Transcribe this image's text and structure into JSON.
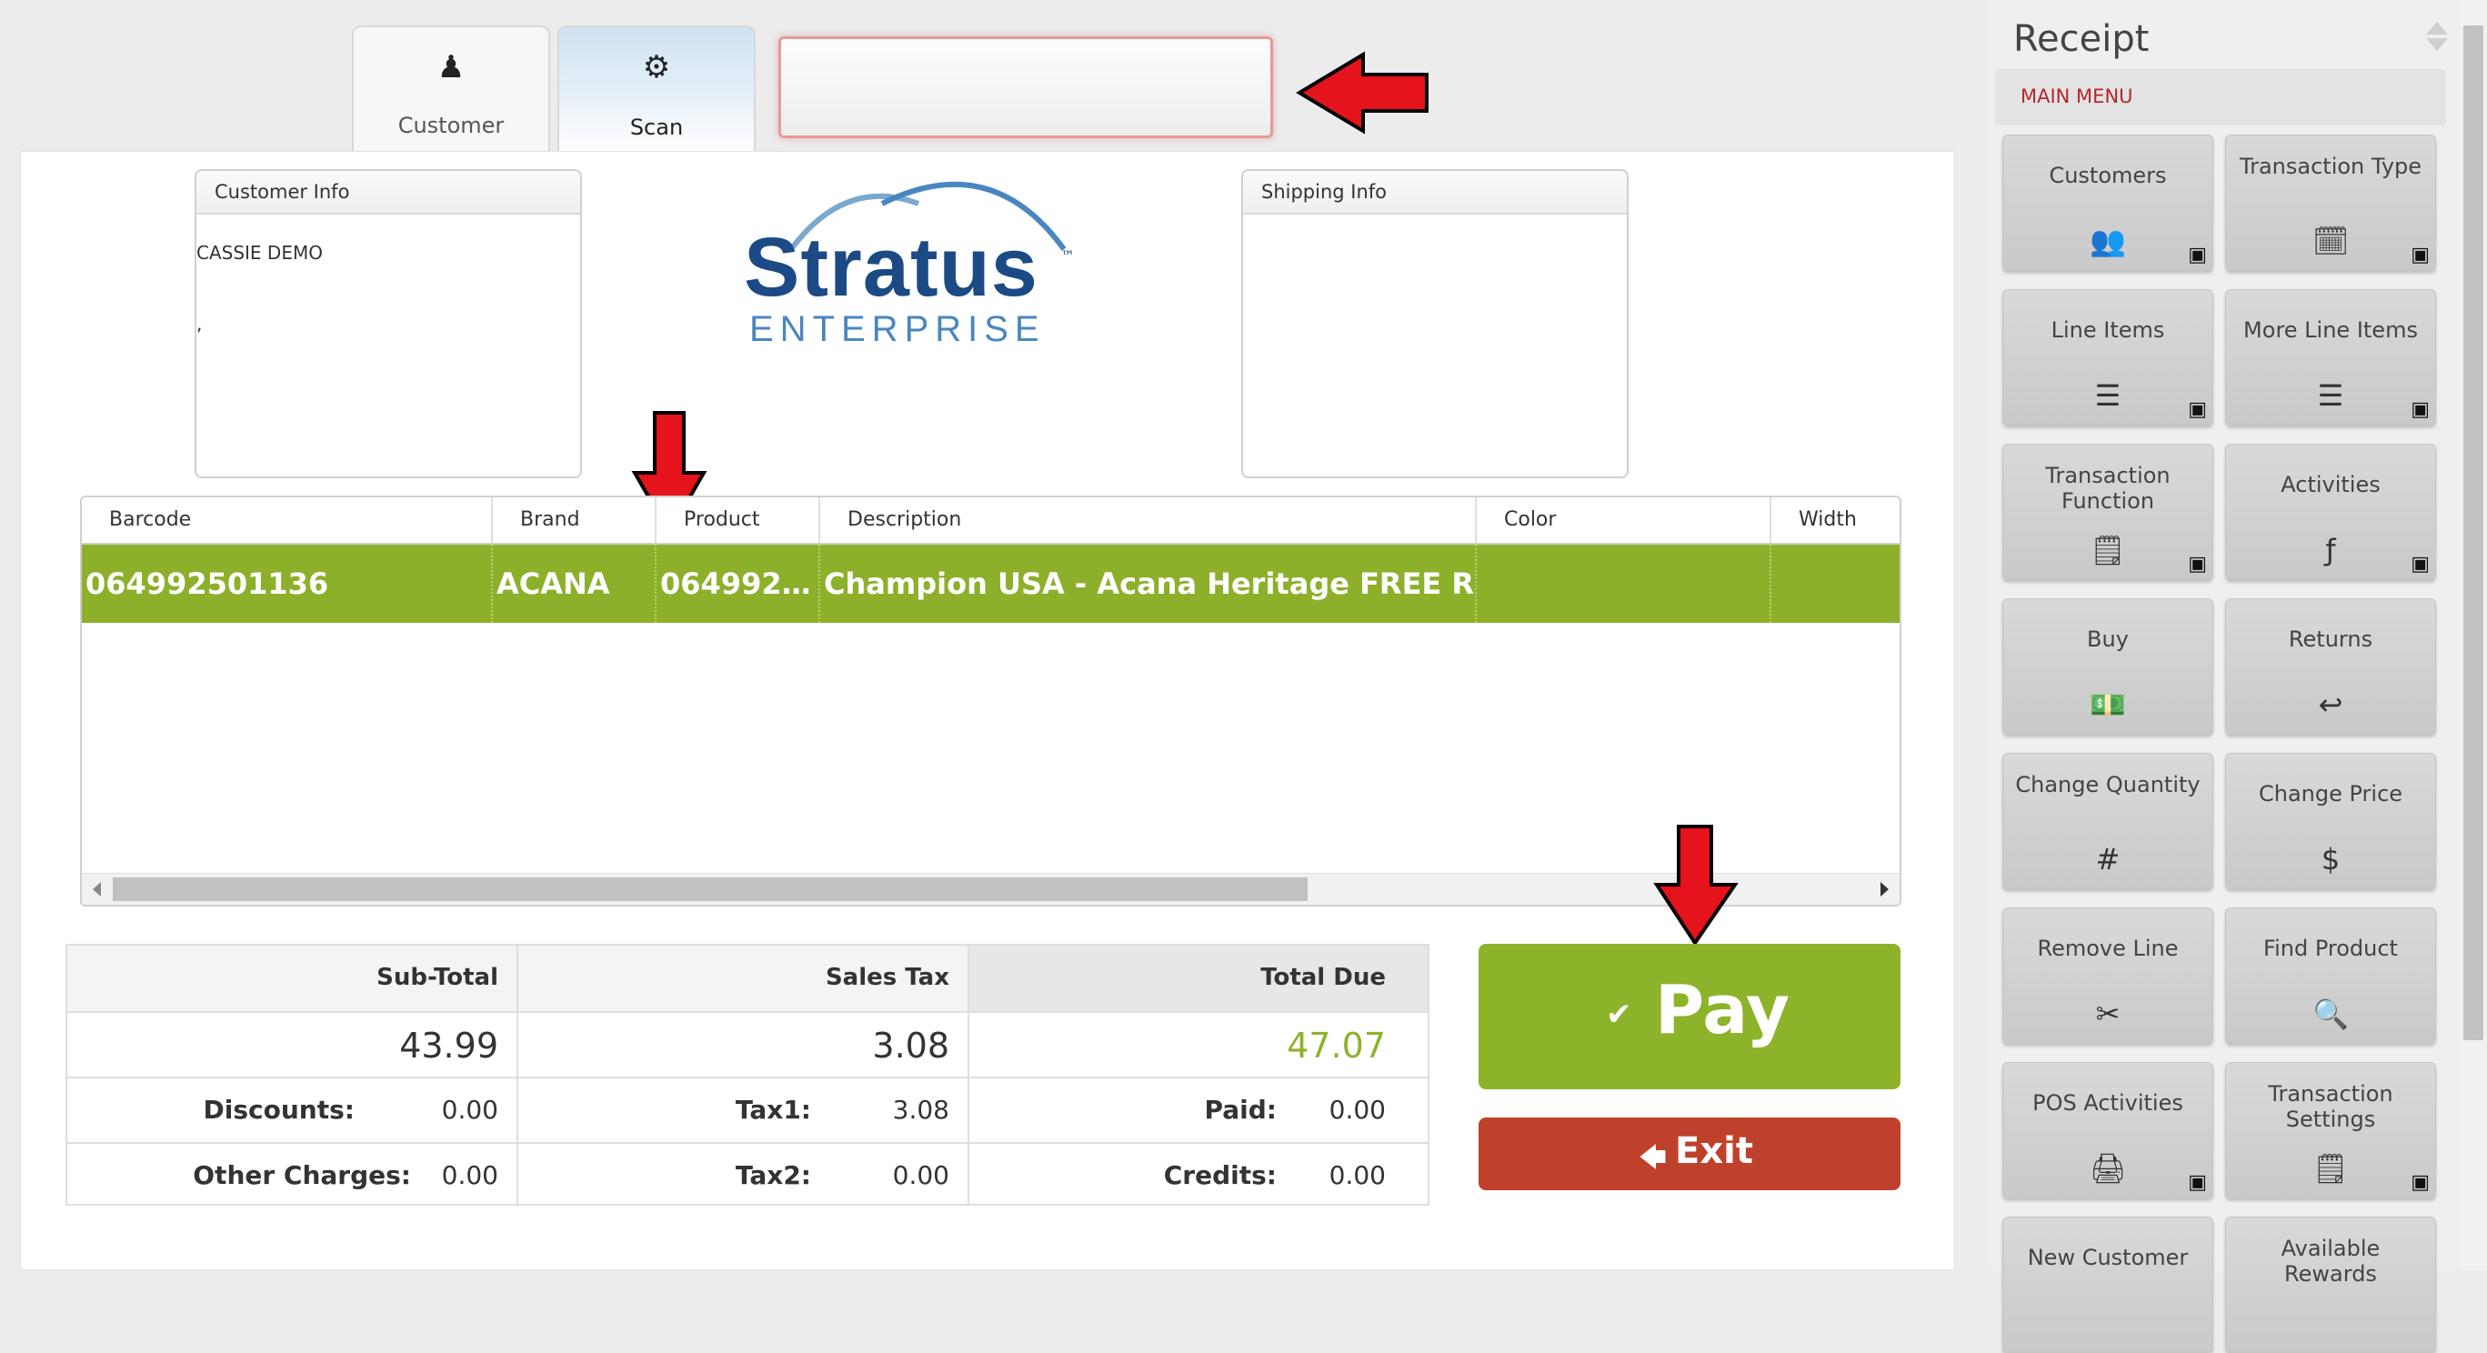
{
  "tabs": [
    {
      "label": "Customer",
      "icon": "person-icon"
    },
    {
      "label": "Scan",
      "icon": "sun-icon"
    }
  ],
  "scan_input": {
    "value": ""
  },
  "customer_info": {
    "header": "Customer Info",
    "name": "CASSIE DEMO",
    "line2": ","
  },
  "logo": {
    "line1": "Stratus",
    "tm": "™",
    "line2": "ENTERPRISE"
  },
  "shipping_info": {
    "header": "Shipping Info"
  },
  "grid": {
    "columns": [
      "Barcode",
      "Brand",
      "Product",
      "Description",
      "Color",
      "Width"
    ],
    "rows": [
      [
        "064992501136",
        "ACANA",
        "0649925…",
        "Champion USA - Acana Heritage FREE RUN PO…",
        "",
        ""
      ]
    ]
  },
  "totals": {
    "subtotal_label": "Sub-Total",
    "subtotal": "43.99",
    "salestax_label": "Sales Tax",
    "salestax": "3.08",
    "totaldue_label": "Total Due",
    "totaldue": "47.07",
    "discounts_label": "Discounts:",
    "discounts": "0.00",
    "tax1_label": "Tax1:",
    "tax1": "3.08",
    "paid_label": "Paid:",
    "paid": "0.00",
    "other_label": "Other Charges:",
    "other": "0.00",
    "tax2_label": "Tax2:",
    "tax2": "0.00",
    "credits_label": "Credits:",
    "credits": "0.00"
  },
  "pay": {
    "label": "Pay",
    "icon": "check-icon"
  },
  "exit": {
    "label": "Exit",
    "icon": "back-arrow-icon"
  },
  "sidebar": {
    "title": "Receipt",
    "menu_label": "MAIN MENU",
    "buttons": [
      {
        "label": "Customers",
        "icon": "customers-icon",
        "glyph": "👥"
      },
      {
        "label": "Transaction Type",
        "icon": "transaction-type-icon",
        "glyph": "🗓"
      },
      {
        "label": "Line Items",
        "icon": "line-items-icon",
        "glyph": "☰"
      },
      {
        "label": "More Line Items",
        "icon": "more-line-items-icon",
        "glyph": "☰"
      },
      {
        "label": "Transaction Function",
        "icon": "transaction-function-icon",
        "glyph": "🗒"
      },
      {
        "label": "Activities",
        "icon": "activities-icon",
        "glyph": "ƒ"
      },
      {
        "label": "Buy",
        "icon": "money-icon",
        "glyph": "💵"
      },
      {
        "label": "Returns",
        "icon": "returns-icon",
        "glyph": "↩"
      },
      {
        "label": "Change Quantity",
        "icon": "change-quantity-icon",
        "glyph": "#"
      },
      {
        "label": "Change Price",
        "icon": "change-price-icon",
        "glyph": "$"
      },
      {
        "label": "Remove Line",
        "icon": "scissors-icon",
        "glyph": "✂"
      },
      {
        "label": "Find Product",
        "icon": "find-product-icon",
        "glyph": "🔍"
      },
      {
        "label": "POS Activities",
        "icon": "pos-activities-icon",
        "glyph": "🖨"
      },
      {
        "label": "Transaction Settings",
        "icon": "transaction-settings-icon",
        "glyph": "🗒"
      },
      {
        "label": "New Customer",
        "icon": "new-customer-icon",
        "glyph": ""
      },
      {
        "label": "Available Rewards",
        "icon": "rewards-icon",
        "glyph": ""
      }
    ]
  },
  "colors": {
    "accent_green": "#8db32b",
    "exit_red": "#c0412b",
    "menu_red": "#b5262e",
    "arrow_red": "#e5131b",
    "total_green": "#8db32b"
  }
}
